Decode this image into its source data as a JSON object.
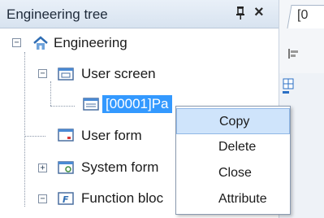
{
  "panel": {
    "title": "Engineering tree",
    "pin_glyph": "↕",
    "close_glyph": "×"
  },
  "tree": {
    "root": {
      "label": "Engineering",
      "expand": "−",
      "icon": "home-icon"
    },
    "user_screen": {
      "label": "User screen",
      "expand": "−",
      "icon": "screen-icon"
    },
    "page": {
      "label": "[00001]Pa",
      "icon": "page-icon"
    },
    "user_form": {
      "label": "User form",
      "icon": "form-icon"
    },
    "system_form": {
      "label": "System form",
      "expand": "+",
      "icon": "system-form-icon"
    },
    "function_block": {
      "label": "Function bloc",
      "expand": "−",
      "icon": "function-icon"
    }
  },
  "right_tab": {
    "label": "[0"
  },
  "context_menu": {
    "items": [
      "Copy",
      "Delete",
      "Close",
      "Attribute"
    ],
    "highlighted": "Copy"
  },
  "colors": {
    "selection": "#3399ff",
    "menu_highlight": "#cfe4fb",
    "titlebar": "#dde6f2"
  }
}
